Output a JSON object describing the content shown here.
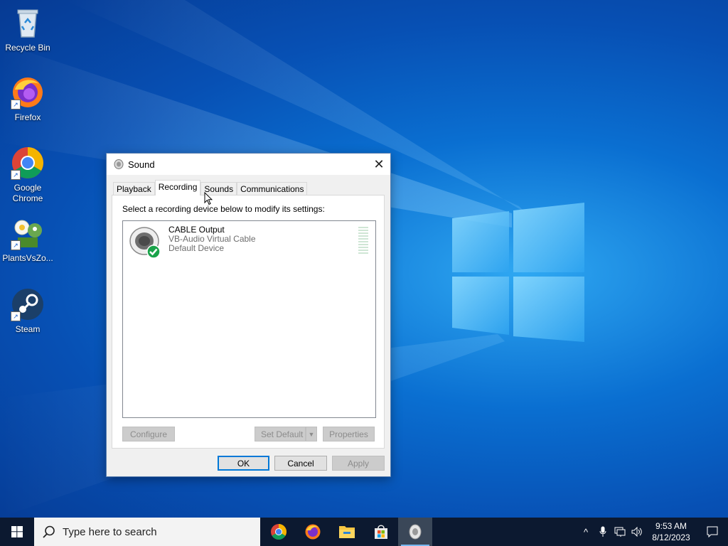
{
  "desktop": {
    "icons": [
      {
        "label": "Recycle Bin",
        "icon": "recycle-bin-icon"
      },
      {
        "label": "Firefox",
        "icon": "firefox-icon"
      },
      {
        "label": "Google Chrome",
        "icon": "chrome-icon"
      },
      {
        "label": "PlantsVsZo...",
        "icon": "plants-vs-zombies-icon"
      },
      {
        "label": "Steam",
        "icon": "steam-icon"
      }
    ]
  },
  "dialog": {
    "title": "Sound",
    "close_glyph": "✕",
    "tabs": [
      {
        "label": "Playback"
      },
      {
        "label": "Recording",
        "active": true
      },
      {
        "label": "Sounds"
      },
      {
        "label": "Communications"
      }
    ],
    "instruction": "Select a recording device below to modify its settings:",
    "device": {
      "name": "CABLE Output",
      "description": "VB-Audio Virtual Cable",
      "status": "Default Device",
      "status_color": "#1aa34a"
    },
    "buttons": {
      "configure": "Configure",
      "set_default": "Set Default",
      "properties": "Properties",
      "ok": "OK",
      "cancel": "Cancel",
      "apply": "Apply"
    }
  },
  "taskbar": {
    "search_placeholder": "Type here to search",
    "apps": [
      "chrome-icon",
      "firefox-icon",
      "file-explorer-icon",
      "microsoft-store-icon",
      "sound-settings-icon"
    ],
    "tray": {
      "chevron": "^",
      "time": "9:53 AM",
      "date": "8/12/2023"
    }
  },
  "colors": {
    "accent": "#0078d7",
    "taskbar": "#0c1930",
    "desktop": "#0a6fd1"
  }
}
